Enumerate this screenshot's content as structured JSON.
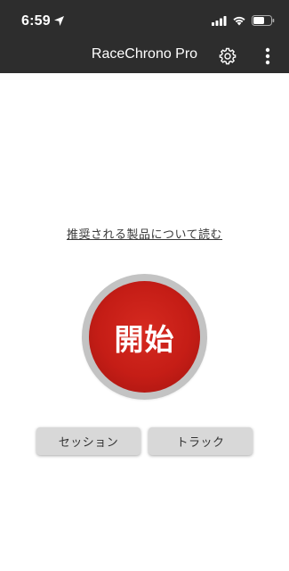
{
  "status_bar": {
    "time": "6:59",
    "icons": [
      "location-arrow-icon",
      "signal-icon",
      "wifi-icon",
      "battery-icon"
    ]
  },
  "app_bar": {
    "title": "RaceChrono Pro",
    "actions": [
      "settings-icon",
      "more-vertical-icon"
    ],
    "background": "#2d2d2d"
  },
  "main": {
    "recommend_link": "推奨される製品について読む",
    "start_label": "開始",
    "session_label": "セッション",
    "track_label": "トラック"
  },
  "colors": {
    "start_red": "#c51d16",
    "ring_gray": "#c3c3c3",
    "button_gray": "#d8d8d8"
  }
}
